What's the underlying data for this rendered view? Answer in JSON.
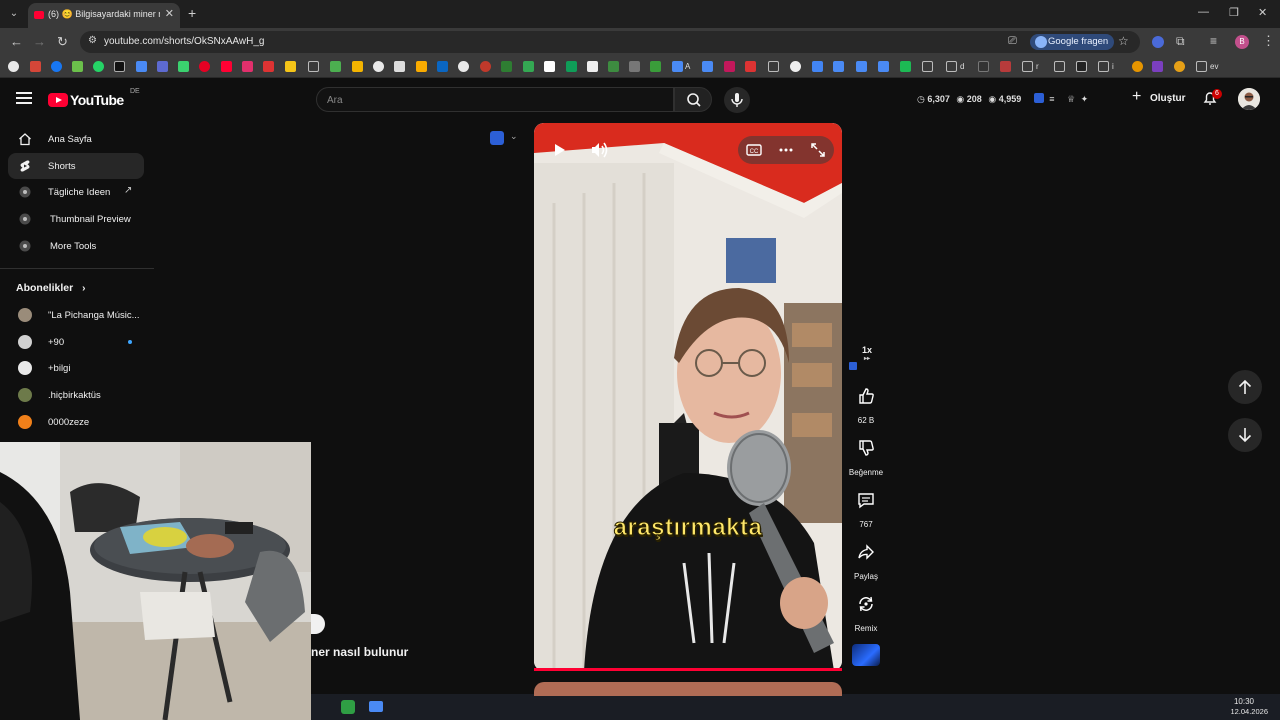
{
  "browser": {
    "tab_title": "(6) 😊 Bilgisayardaki miner nasıl",
    "url": "youtube.com/shorts/OkSNxAAwH_g",
    "google_fragen": "Google fragen",
    "bookmark_labels": [
      "A",
      "d",
      "r",
      "i",
      "iş",
      "ev"
    ]
  },
  "header": {
    "logo_text": "YouTube",
    "region": "DE",
    "search_placeholder": "Ara",
    "stat1": "6,307",
    "stat2": "208",
    "stat3": "4,959",
    "create_label": "Oluştur",
    "notif_count": "6"
  },
  "sidebar": {
    "items": [
      {
        "label": "Ana Sayfa",
        "icon": "home-icon"
      },
      {
        "label": "Shorts",
        "icon": "shorts-icon"
      },
      {
        "label": "Tägliche Ideen",
        "icon": "ideas-icon"
      },
      {
        "label": "Thumbnail Preview",
        "icon": "thumbnail-icon"
      },
      {
        "label": "More Tools",
        "icon": "tools-icon"
      }
    ],
    "subs_heading": "Abonelikler",
    "channels": [
      {
        "name": "\"La Pichanga Músic...",
        "color": "#9a8c7a"
      },
      {
        "name": "+90",
        "color": "#d0d0d0"
      },
      {
        "name": "+bilgi",
        "color": "#e8e8e8"
      },
      {
        "name": ".hiçbirkaktüs",
        "color": "#6d7a4a"
      },
      {
        "name": "0000zeze",
        "color": "#f0801a"
      }
    ]
  },
  "video": {
    "caption": "araştırmakta",
    "title_fragment": "ner nasıl bulunur",
    "speed": "1x",
    "likes": "62 B",
    "dislike_label": "Beğenme",
    "comments": "767",
    "share_label": "Paylaş",
    "remix_label": "Remix"
  },
  "taskbar": {
    "time": "10:30",
    "date": "12.04.2026"
  },
  "colors": {
    "brand_red": "#ff0033",
    "bg": "#0f0f0f",
    "caption_yellow": "#ffe86b"
  }
}
